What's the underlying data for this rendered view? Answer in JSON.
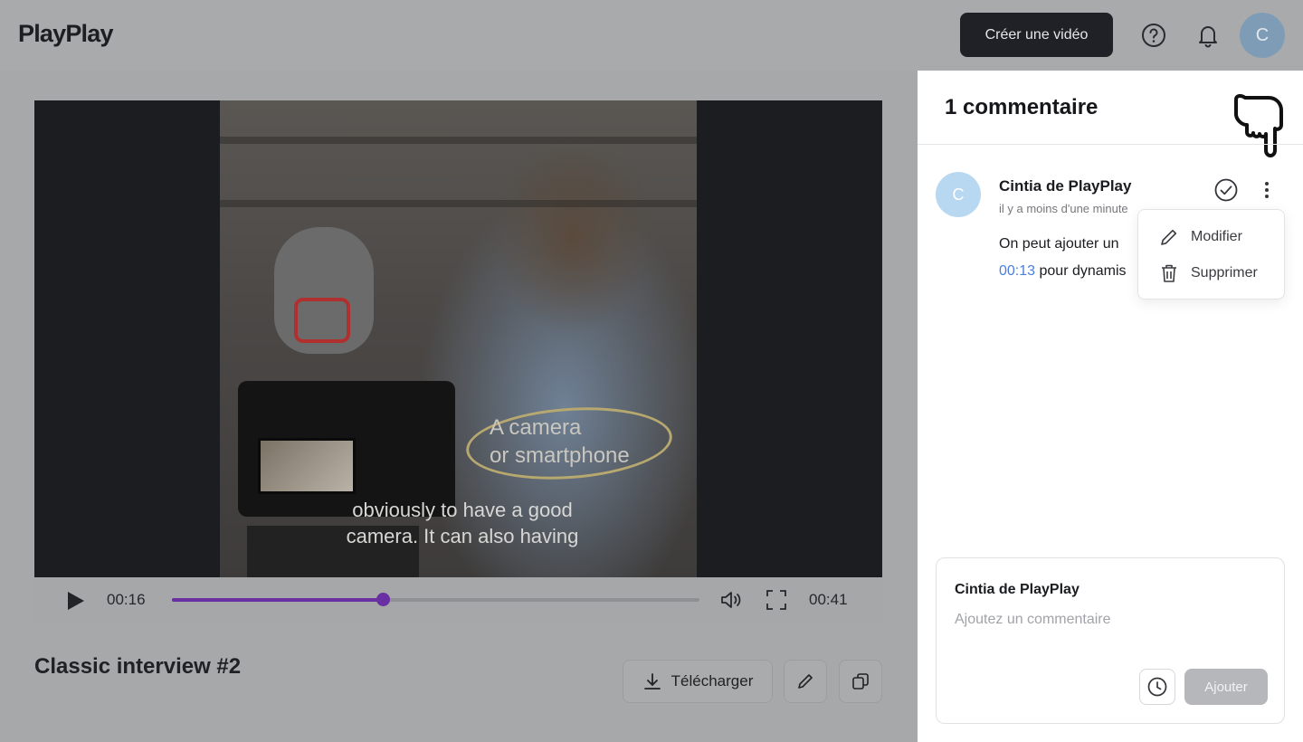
{
  "header": {
    "logo": "PlayPlay",
    "create_button": "Créer une vidéo",
    "avatar_initial": "C"
  },
  "video": {
    "subtitle_line1": "obviously to have a good",
    "subtitle_line2": "camera. It can also having",
    "annotation_line1": "A camera",
    "annotation_line2": "or smartphone",
    "current_time": "00:16",
    "duration": "00:41",
    "progress": 0.4,
    "title": "Classic interview #2",
    "download_label": "Télécharger"
  },
  "panel": {
    "title": "1 commentaire",
    "comment": {
      "avatar_initial": "C",
      "author": "Cintia de PlayPlay",
      "time": "il y a moins d'une minute",
      "text_line1": "On peut ajouter un",
      "timestamp": "00:13",
      "text_line2_rest": " pour dynamis"
    },
    "menu": {
      "edit": "Modifier",
      "delete": "Supprimer"
    },
    "composer": {
      "author": "Cintia de PlayPlay",
      "placeholder": "Ajoutez un commentaire",
      "add_button": "Ajouter"
    }
  },
  "colors": {
    "accent": "#6a2fa3",
    "timestamp_link": "#4a7fe0",
    "avatar": "#b8d8f2"
  }
}
